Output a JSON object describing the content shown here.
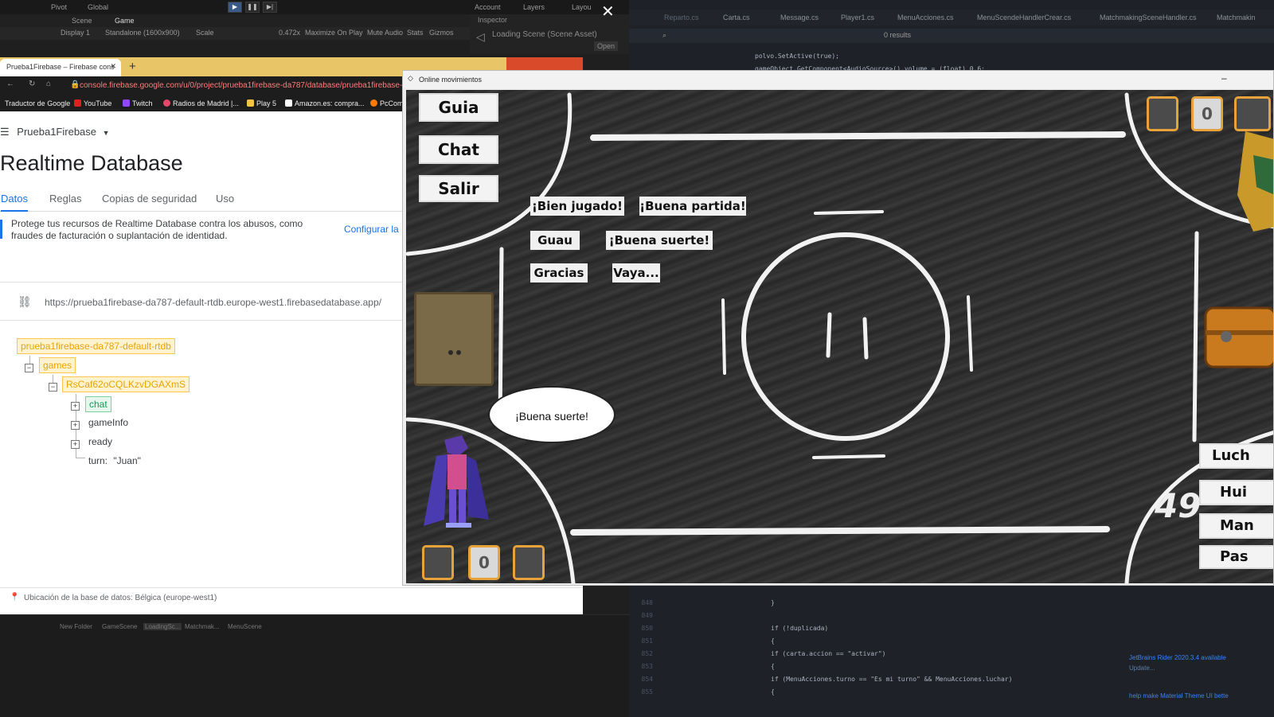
{
  "unity": {
    "toolbar": {
      "pivot": "Pivot",
      "global": "Global",
      "account": "Account",
      "layers": "Layers",
      "layout": "Layou"
    },
    "tabs": {
      "scene": "Scene",
      "game": "Game",
      "inspector": "Inspector"
    },
    "game_bar": {
      "display": "Display 1",
      "resolution": "Standalone (1600x900)",
      "scale_label": "Scale",
      "scale_value": "0.472x",
      "maximize": "Maximize On Play",
      "mute": "Mute Audio",
      "stats": "Stats",
      "gizmos": "Gizmos"
    },
    "inspector_text": "Loading Scene (Scene Asset)",
    "inspector_open": "Open",
    "project_items": [
      "New Folder",
      "GameScene",
      "LoadingSc...",
      "Matchmak...",
      "MenuScene"
    ]
  },
  "rider": {
    "tabs": [
      "Reparto.cs",
      "Carta.cs",
      "Message.cs",
      "Player1.cs",
      "MenuAcciones.cs",
      "MenuScendeHandlerCrear.cs",
      "MatchmakingSceneHandler.cs",
      "Matchmakin"
    ],
    "search_results": "0 results",
    "code_top": [
      {
        "no": "",
        "text": "polvo.SetActive(true);"
      },
      {
        "no": "",
        "text": "gameObject.GetComponent<AudioSource>().volume = (float) 0.6;"
      }
    ],
    "code_bottom": [
      {
        "no": "848",
        "text": "}"
      },
      {
        "no": "849",
        "text": ""
      },
      {
        "no": "850",
        "text": "if (!duplicada)"
      },
      {
        "no": "851",
        "text": "{"
      },
      {
        "no": "852",
        "text": "    if (carta.accion == \"activar\")"
      },
      {
        "no": "853",
        "text": "    {"
      },
      {
        "no": "854",
        "text": "        if (MenuAcciones.turno == \"Es mi turno\" && MenuAcciones.luchar)"
      },
      {
        "no": "855",
        "text": "        {"
      }
    ],
    "notification_title": "JetBrains Rider 2020.3.4 available",
    "notification_link": "Update...",
    "notification_2": "help make Material Theme UI bette"
  },
  "chrome": {
    "tab_title": "Prueba1Firebase – Firebase cons",
    "new_tab": "+",
    "address": "console.firebase.google.com/u/0/project/prueba1firebase-da787/database/prueba1firebase-d",
    "bookmarks": [
      "Traductor de Google",
      "YouTube",
      "Twitch",
      "Radios de Madrid |...",
      "Play 5",
      "Amazon.es: compra...",
      "PcCom"
    ]
  },
  "firebase": {
    "project": "Prueba1Firebase",
    "title": "Realtime Database",
    "tabs": [
      "Datos",
      "Reglas",
      "Copias de seguridad",
      "Uso"
    ],
    "notice": "Protege tus recursos de Realtime Database contra los abusos, como fraudes de facturación o suplantación de identidad.",
    "configure": "Configurar la",
    "db_url": "https://prueba1firebase-da787-default-rtdb.europe-west1.firebasedatabase.app/",
    "tree": {
      "root": "prueba1firebase-da787-default-rtdb",
      "games": "games",
      "game_id": "RsCaf62oCQLKzvDGAXmS",
      "chat": "chat",
      "gameInfo": "gameInfo",
      "ready": "ready",
      "turn_key": "turn:",
      "turn_value": "\"Juan\""
    },
    "footer": "Ubicación de la base de datos: Bélgica (europe-west1)"
  },
  "game": {
    "window_title": "Online movimientos",
    "menu_buttons": [
      "Guia",
      "Chat",
      "Salir"
    ],
    "quick_chat": [
      "¡Bien jugado!",
      "¡Buena partida!",
      "Guau",
      "¡Buena suerte!",
      "Gracias",
      "Vaya..."
    ],
    "speech_bubble": "¡Buena suerte!",
    "timer": "49",
    "player_counter": "0",
    "opponent_counter": "0",
    "action_buttons": [
      "Luch",
      "Hui",
      "Man",
      "Pas"
    ]
  }
}
